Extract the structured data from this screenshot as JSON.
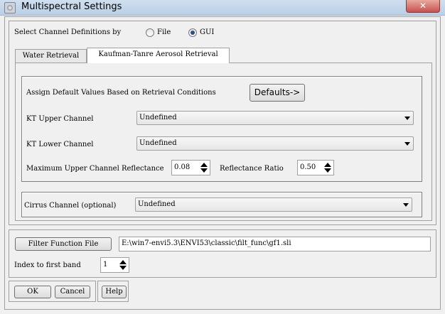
{
  "window": {
    "title": "Multispectral Settings",
    "close_glyph": "✕"
  },
  "channel_definitions": {
    "label": "Select Channel Definitions by",
    "options": [
      {
        "label": "File",
        "checked": false
      },
      {
        "label": "GUI",
        "checked": true
      }
    ]
  },
  "tabs": [
    {
      "label": "Water Retrieval",
      "active": false
    },
    {
      "label": "Kaufman-Tanre Aerosol Retrieval",
      "active": true
    }
  ],
  "aerosol": {
    "defaults_label": "Assign Default Values Based on Retrieval Conditions",
    "defaults_button": "Defaults->",
    "kt_upper_label": "KT Upper Channel",
    "kt_upper_value": "Undefined",
    "kt_lower_label": "KT Lower Channel",
    "kt_lower_value": "Undefined",
    "max_upper_label": "Maximum Upper Channel Reflectance",
    "max_upper_value": "0.08",
    "ratio_label": "Reflectance Ratio",
    "ratio_value": "0.50",
    "cirrus_label": "Cirrus Channel (optional)",
    "cirrus_value": "Undefined"
  },
  "filter": {
    "button_label": "Filter Function File",
    "path": "E:\\win7-envi5.3\\ENVI53\\classic\\filt_func\\gf1.sli",
    "index_label": "Index to first band",
    "index_value": "1"
  },
  "footer": {
    "ok_label": "OK",
    "cancel_label": "Cancel",
    "help_label": "Help"
  },
  "colors": {
    "radio_dot": "#2a4f8a",
    "close_button": "#c75050"
  }
}
